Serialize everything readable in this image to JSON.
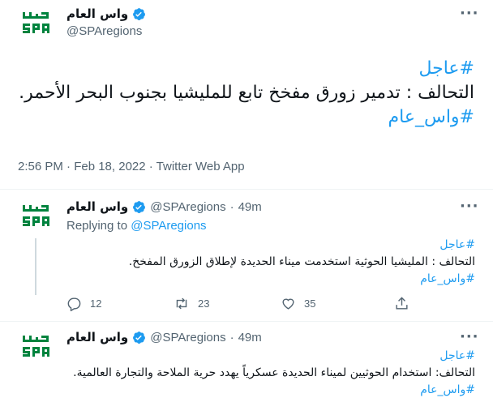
{
  "main_tweet": {
    "display_name": "واس العام",
    "handle": "@SPAregions",
    "hashtag_top": "#عاجل",
    "body": "التحالف : تدمير زورق مفخخ تابع للمليشيا بجنوب البحر الأحمر.",
    "hashtag_bottom": "#واس_عام",
    "timestamp": "2:56 PM · Feb 18, 2022 · Twitter Web App"
  },
  "replies": [
    {
      "display_name": "واس العام",
      "handle": "@SPAregions",
      "age": "49m",
      "replying_prefix": "Replying to ",
      "replying_handle": "@SPAregions",
      "hashtag_top": "#عاجل",
      "body": "التحالف : المليشيا الحوثية استخدمت ميناء الحديدة لإطلاق الزورق المفخخ.",
      "hashtag_bottom": "#واس_عام",
      "stats": {
        "replies": "12",
        "retweets": "23",
        "likes": "35"
      }
    },
    {
      "display_name": "واس العام",
      "handle": "@SPAregions",
      "age": "49m",
      "hashtag_top": "#عاجل",
      "body": "التحالف: استخدام الحوثيين لميناء الحديدة عسكرياً يهدد حرية الملاحة والتجارة العالمية.",
      "hashtag_bottom": "#واس_عام"
    }
  ],
  "icons": {
    "avatar": "spa-logo-icon",
    "verified": "verified-badge-icon",
    "more": "more-options-icon",
    "reply": "reply-icon",
    "retweet": "retweet-icon",
    "like": "like-icon",
    "share": "share-icon"
  },
  "colors": {
    "accent": "#1d9bf0",
    "logo_green": "#00833e",
    "secondary_text": "#536471"
  }
}
